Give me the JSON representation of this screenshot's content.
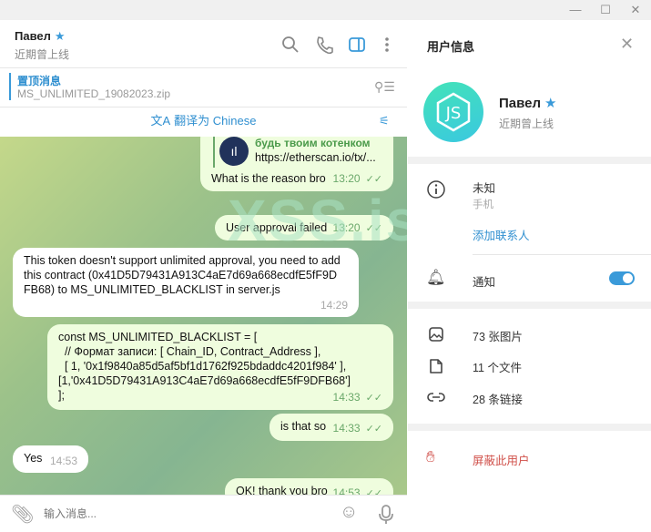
{
  "window": {
    "controls": [
      "minimize",
      "maximize",
      "close"
    ]
  },
  "chat": {
    "header": {
      "name": "Павел",
      "status": "近期曾上线",
      "icons": [
        "search-icon",
        "phone-icon",
        "sidebar-icon",
        "more-icon"
      ]
    },
    "pinned": {
      "title": "置顶消息",
      "text": "MS_UNLIMITED_19082023.zip"
    },
    "translate": {
      "label": "翻译为 Chinese"
    },
    "watermark": "XSS.is",
    "messages": [
      {
        "dir": "out",
        "preview_title": "будь твоим котенком",
        "preview_url": "https://etherscan.io/tx/...",
        "text": "What is the reason bro",
        "time": "13:20"
      },
      {
        "dir": "out",
        "text": "User approval failed",
        "time": "13:20"
      },
      {
        "dir": "in",
        "text": "This token doesn't support unlimited approval, you need to add this contract (0x41D5D79431A913C4aE7d69a668ecdfE5fF9DFB68) to MS_UNLIMITED_BLACKLIST in server.js",
        "time": "14:29"
      },
      {
        "dir": "out",
        "lines": [
          "const MS_UNLIMITED_BLACKLIST = [",
          "  // Формат записи: [ Chain_ID, Contract_Address ],",
          "  [ 1, '0x1f9840a85d5af5bf1d1762f925bdaddc4201f984' ],",
          "[1,'0x41D5D79431A913C4aE7d69a668ecdfE5fF9DFB68']",
          "];"
        ],
        "time": "14:33"
      },
      {
        "dir": "out",
        "text": "is that so",
        "time": "14:33"
      },
      {
        "dir": "in",
        "text": "Yes",
        "time": "14:53"
      },
      {
        "dir": "out",
        "text": "OK! thank you bro",
        "time": "14:53"
      }
    ],
    "input": {
      "placeholder": "输入消息..."
    }
  },
  "panel": {
    "title": "用户信息",
    "name": "Павел",
    "status": "近期曾上线",
    "phone": "未知",
    "phone_label": "手机",
    "add_contact": "添加联系人",
    "notifications": "通知",
    "notifications_on": true,
    "photos": "73 张图片",
    "files": "11 个文件",
    "links": "28 条链接",
    "block": "屏蔽此用户",
    "colors": {
      "accent": "#3a9ad9",
      "danger": "#d0504a",
      "avatar": "#3fd6c0"
    }
  }
}
